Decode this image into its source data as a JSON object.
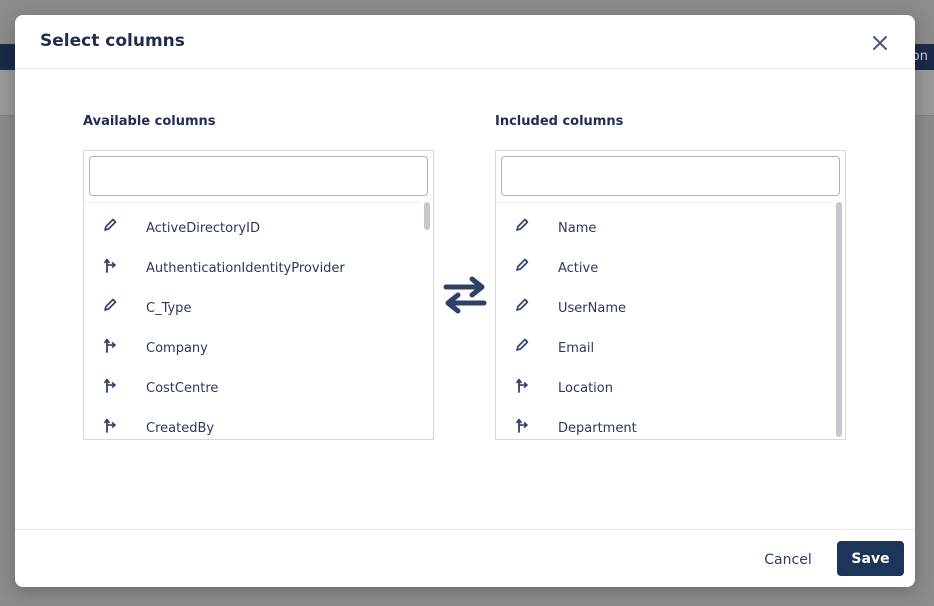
{
  "background": {
    "topbar_text": "on"
  },
  "modal": {
    "title": "Select columns",
    "available": {
      "label": "Available columns",
      "search_value": "",
      "items": [
        {
          "label": "ActiveDirectoryID",
          "icon": "pencil-icon"
        },
        {
          "label": "AuthenticationIdentityProvider",
          "icon": "link-arrow-icon"
        },
        {
          "label": "C_Type",
          "icon": "pencil-icon"
        },
        {
          "label": "Company",
          "icon": "link-arrow-icon"
        },
        {
          "label": "CostCentre",
          "icon": "link-arrow-icon"
        },
        {
          "label": "CreatedBy",
          "icon": "link-arrow-icon"
        }
      ]
    },
    "included": {
      "label": "Included columns",
      "search_value": "",
      "items": [
        {
          "label": "Name",
          "icon": "pencil-icon"
        },
        {
          "label": "Active",
          "icon": "pencil-icon"
        },
        {
          "label": "UserName",
          "icon": "pencil-icon"
        },
        {
          "label": "Email",
          "icon": "pencil-icon"
        },
        {
          "label": "Location",
          "icon": "link-arrow-icon"
        },
        {
          "label": "Department",
          "icon": "link-arrow-icon"
        }
      ]
    },
    "footer": {
      "cancel_label": "Cancel",
      "save_label": "Save"
    }
  },
  "colors": {
    "primary": "#1c3559",
    "text": "#1f2e4d",
    "overlay": "#8c8c8c"
  }
}
